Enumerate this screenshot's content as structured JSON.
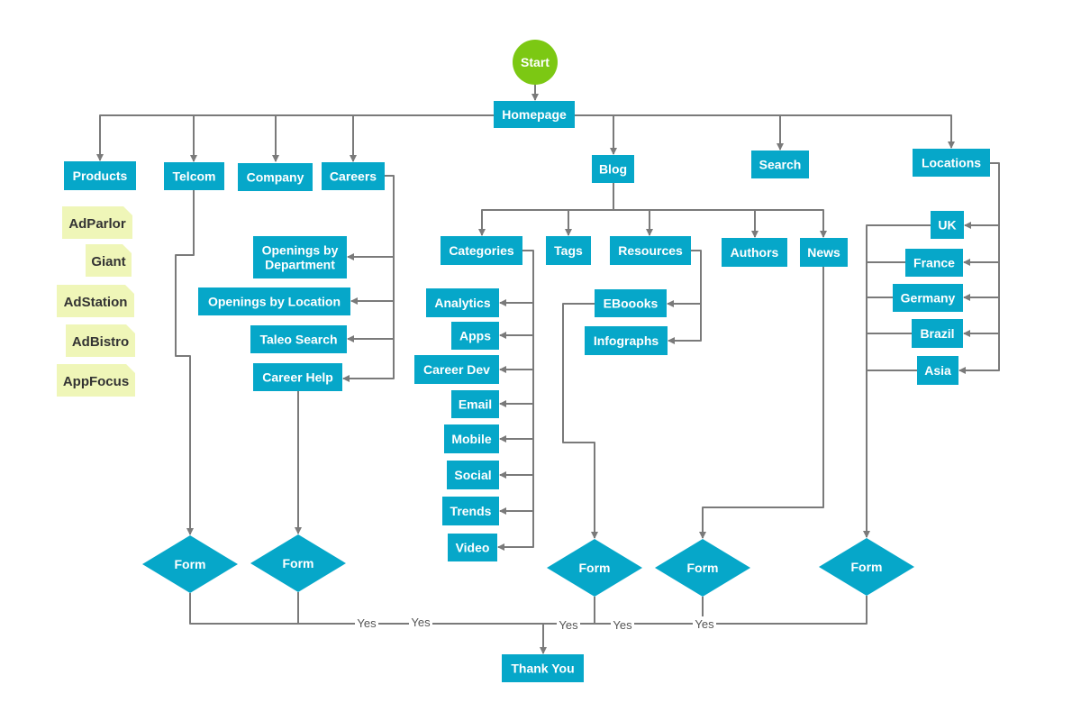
{
  "colors": {
    "node": "#06a7c9",
    "start": "#7cc813",
    "note": "#eff6b8",
    "connector": "#7a7a7a"
  },
  "nodes": {
    "start": "Start",
    "homepage": "Homepage",
    "products": "Products",
    "telcom": "Telcom",
    "company": "Company",
    "careers": "Careers",
    "blog": "Blog",
    "search": "Search",
    "locations": "Locations",
    "openings_dept_1": "Openings by",
    "openings_dept_2": "Department",
    "openings_loc": "Openings by Location",
    "taleo": "Taleo Search",
    "career_help": "Career Help",
    "categories": "Categories",
    "tags": "Tags",
    "resources": "Resources",
    "authors": "Authors",
    "news": "News",
    "analytics": "Analytics",
    "apps": "Apps",
    "career_dev": "Career Dev",
    "email": "Email",
    "mobile": "Mobile",
    "social": "Social",
    "trends": "Trends",
    "video": "Video",
    "ebooks": "EBoooks",
    "infographs": "Infographs",
    "uk": "UK",
    "france": "France",
    "germany": "Germany",
    "brazil": "Brazil",
    "asia": "Asia",
    "thank_you": "Thank You"
  },
  "notes": [
    "AdParlor",
    "Giant",
    "AdStation",
    "AdBistro",
    "AppFocus"
  ],
  "forms": [
    "Form",
    "Form",
    "Form",
    "Form",
    "Form"
  ],
  "yes_labels": [
    "Yes",
    "Yes",
    "Yes",
    "Yes",
    "Yes"
  ]
}
